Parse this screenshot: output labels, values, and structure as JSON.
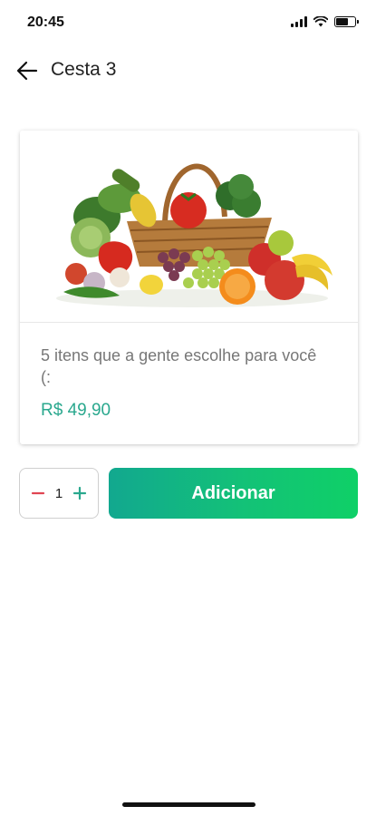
{
  "status_bar": {
    "time": "20:45",
    "icons": [
      "cellular-signal-icon",
      "wifi-icon",
      "battery-icon"
    ]
  },
  "header": {
    "back_icon": "arrow-left-icon",
    "title": "Cesta 3"
  },
  "product": {
    "image": "fruit-and-vegetable-basket",
    "description": "5 itens que a gente escolhe para você (:",
    "price": "R$ 49,90"
  },
  "actions": {
    "quantity": "1",
    "decrement_icon": "minus-icon",
    "increment_icon": "plus-icon",
    "add_label": "Adicionar"
  },
  "colors": {
    "accent": "#2aa88e",
    "decrement": "#e04552",
    "button_gradient_start": "#12a88f",
    "button_gradient_end": "#0fd067"
  }
}
